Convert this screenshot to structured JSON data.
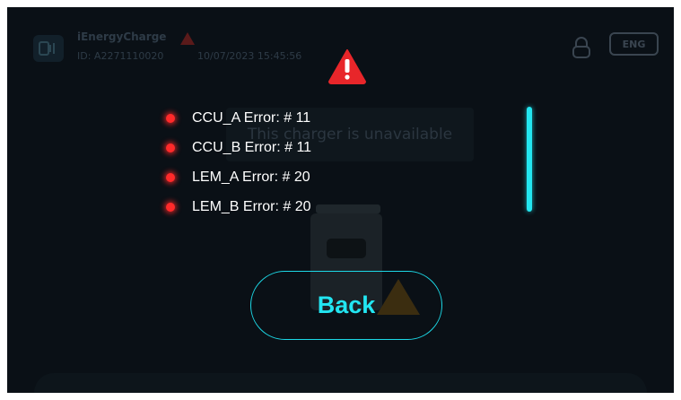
{
  "header": {
    "brand": "iEnergyCharge",
    "device_id": "ID: A2271110020",
    "datetime": "10/07/2023  15:45:56",
    "language": "ENG"
  },
  "status": {
    "message": "This charger is unavailable"
  },
  "alert": {
    "icon": "warning-icon",
    "errors": [
      {
        "label": "CCU_A Error: # 11"
      },
      {
        "label": "CCU_B Error: # 11"
      },
      {
        "label": "LEM_A Error: # 20"
      },
      {
        "label": "LEM_B Error: # 20"
      }
    ],
    "back_label": "Back"
  },
  "colors": {
    "accent": "#22e6f2",
    "error_dot": "#ff2a2a",
    "warning": "#e8262a",
    "background": "#0a1016"
  }
}
